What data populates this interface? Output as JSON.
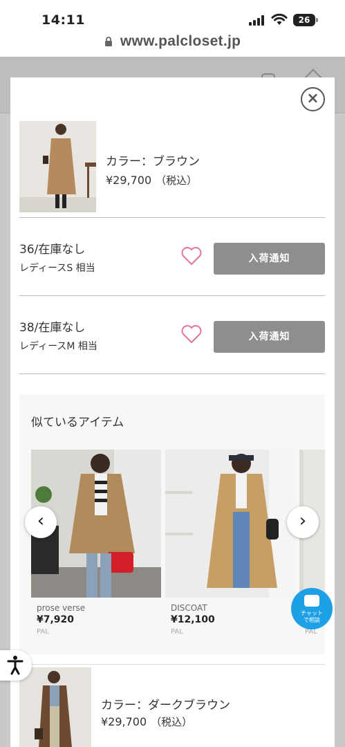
{
  "status_bar": {
    "time": "14:11",
    "battery": "26"
  },
  "browser": {
    "url": "www.palcloset.jp"
  },
  "modal": {
    "close_label": "×",
    "product": {
      "color_label": "カラー：ブラウン",
      "price": "¥29,700",
      "tax": "（税込）"
    },
    "sizes": [
      {
        "title": "36/在庫なし",
        "sub": "レディースS 相当",
        "button": "入荷通知"
      },
      {
        "title": "38/在庫なし",
        "sub": "レディースM 相当",
        "button": "入荷通知"
      }
    ],
    "similar": {
      "title": "似ているアイテム",
      "items": [
        {
          "brand": "prose verse",
          "price": "¥7,920",
          "shop": "PAL"
        },
        {
          "brand": "DISCOAT",
          "price": "¥12,100",
          "shop": "PAL"
        },
        {
          "brand": "",
          "price": "",
          "shop": "PAL"
        }
      ]
    },
    "product_2": {
      "color_label": "カラー：ダークブラウン",
      "price": "¥29,700",
      "tax": "（税込）"
    }
  },
  "chat": {
    "label_line1": "チャット",
    "label_line2": "で相談"
  },
  "colors": {
    "notify_button": "#8e8e8e",
    "heart": "#e5739a",
    "chat": "#1ea0e6"
  },
  "icons": [
    "signal-icon",
    "wifi-icon",
    "battery-icon",
    "lock-icon",
    "close-icon",
    "heart-icon",
    "chevron-left-icon",
    "chevron-right-icon",
    "chat-icon",
    "accessibility-icon"
  ]
}
